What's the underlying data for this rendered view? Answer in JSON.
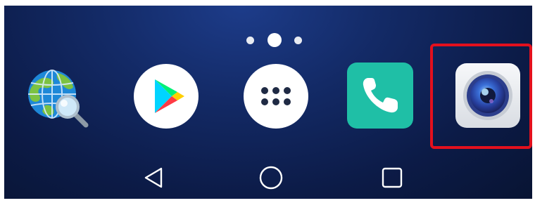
{
  "home_screen": {
    "page_indicator": {
      "pages": 3,
      "current_page": 2
    },
    "dock": [
      {
        "name": "browser-globe-search-app",
        "icon": "globe-magnifier-icon"
      },
      {
        "name": "play-store-app",
        "icon": "play-store-icon",
        "colors": [
          "#00d4ff",
          "#00f076",
          "#ffcf00",
          "#ff3a44"
        ]
      },
      {
        "name": "app-drawer",
        "icon": "app-drawer-dots-icon"
      },
      {
        "name": "phone-app",
        "icon": "phone-handset-icon",
        "color": "#1fbfa6"
      },
      {
        "name": "camera-app",
        "icon": "camera-lens-icon",
        "highlighted": true
      }
    ],
    "highlight_color": "#e3101d"
  },
  "navigation_bar": {
    "buttons": [
      {
        "name": "back",
        "icon": "back-triangle-icon"
      },
      {
        "name": "home",
        "icon": "home-circle-icon"
      },
      {
        "name": "recents",
        "icon": "recents-square-icon"
      }
    ]
  }
}
